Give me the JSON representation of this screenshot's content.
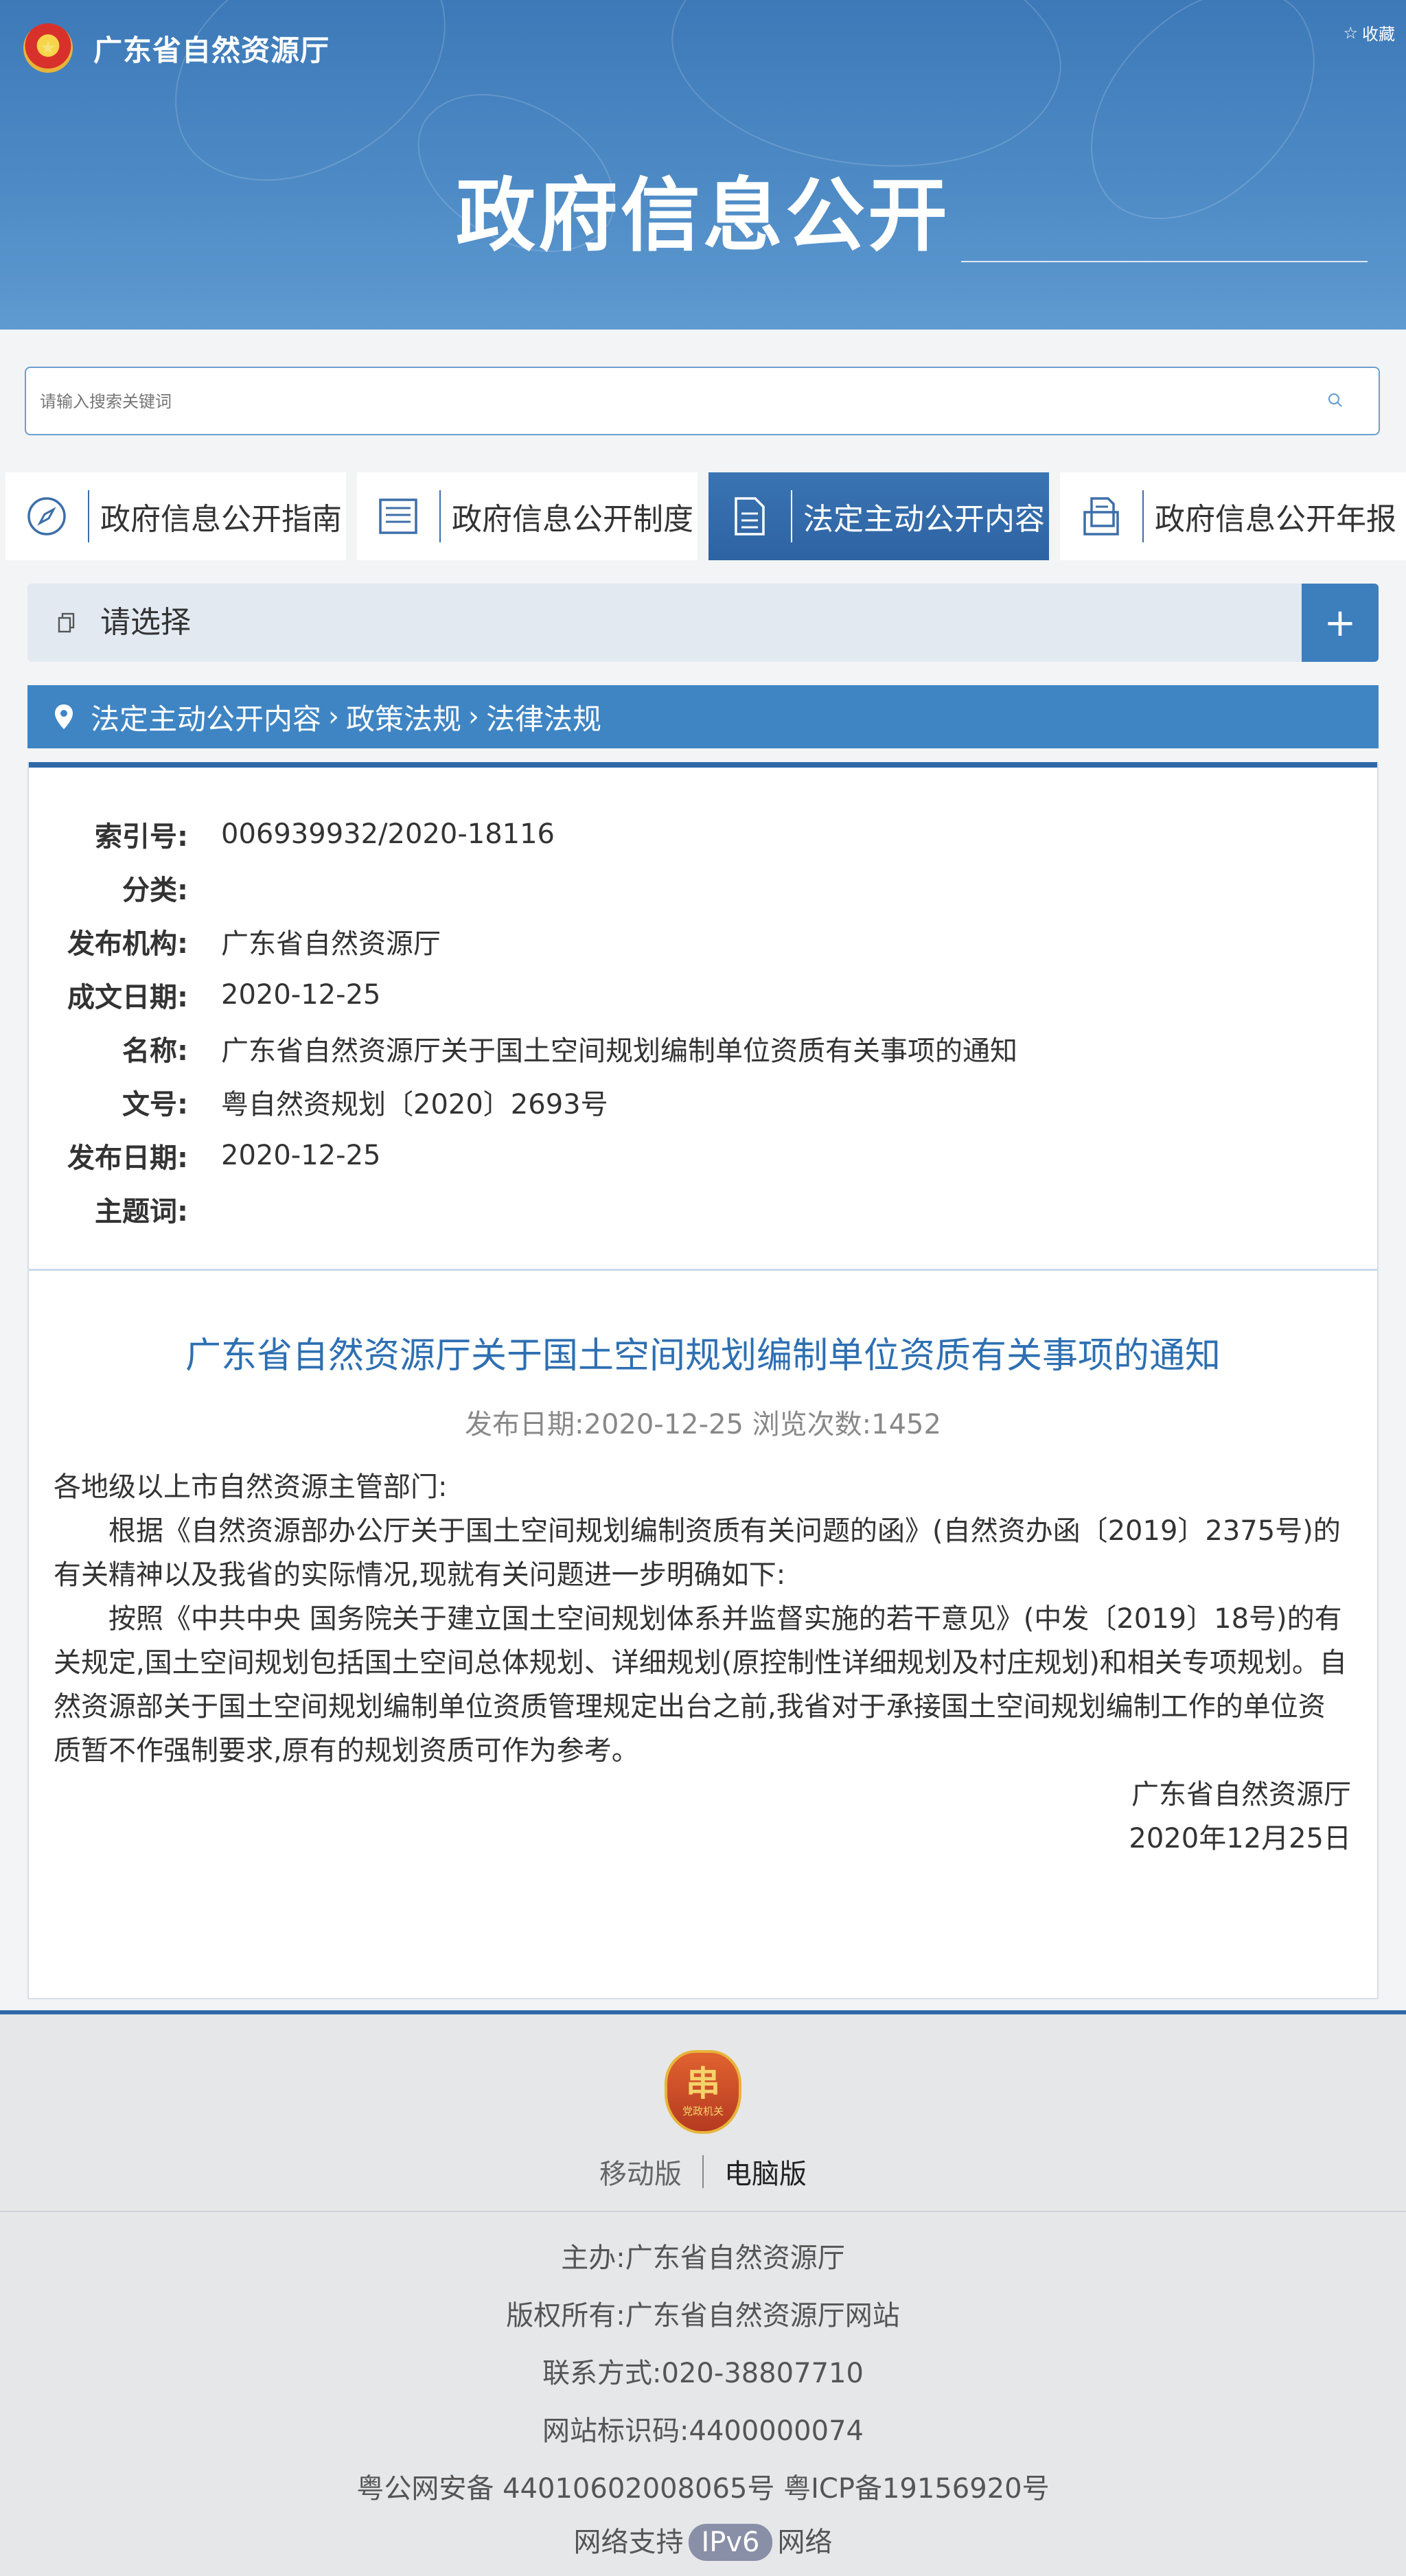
{
  "header": {
    "site_name": "广东省自然资源厅",
    "favorite_label": "收藏",
    "banner_title": "政府信息公开"
  },
  "search": {
    "placeholder": "请输入搜索关键词"
  },
  "tabs": [
    {
      "label": "政府信息公开指南",
      "icon": "compass-icon",
      "active": false
    },
    {
      "label": "政府信息公开制度",
      "icon": "list-icon",
      "active": false
    },
    {
      "label": "法定主动公开内容",
      "icon": "document-icon",
      "active": true
    },
    {
      "label": "政府信息公开年报",
      "icon": "report-icon",
      "active": false
    }
  ],
  "selector": {
    "label": "请选择",
    "expand_symbol": "+"
  },
  "breadcrumb": {
    "items": [
      "法定主动公开内容",
      "政策法规",
      "法律法规"
    ]
  },
  "meta": [
    {
      "key": "索引号:",
      "value": "006939932/2020-18116"
    },
    {
      "key": "分类:",
      "value": ""
    },
    {
      "key": "发布机构:",
      "value": "广东省自然资源厅"
    },
    {
      "key": "成文日期:",
      "value": "2020-12-25"
    },
    {
      "key": "名称:",
      "value": "广东省自然资源厅关于国土空间规划编制单位资质有关事项的通知"
    },
    {
      "key": "文号:",
      "value": "粤自然资规划〔2020〕2693号"
    },
    {
      "key": "发布日期:",
      "value": "2020-12-25"
    },
    {
      "key": "主题词:",
      "value": ""
    }
  ],
  "article": {
    "title": "广东省自然资源厅关于国土空间规划编制单位资质有关事项的通知",
    "info": "发布日期:2020-12-25  浏览次数:1452",
    "greeting": "各地级以上市自然资源主管部门:",
    "para1": "根据《自然资源部办公厅关于国土空间规划编制资质有关问题的函》(自然资办函〔2019〕2375号)的有关精神以及我省的实际情况,现就有关问题进一步明确如下:",
    "para2": "按照《中共中央 国务院关于建立国土空间规划体系并监督实施的若干意见》(中发〔2019〕18号)的有关规定,国土空间规划包括国土空间总体规划、详细规划(原控制性详细规划及村庄规划)和相关专项规划。自然资源部关于国土空间规划编制单位资质管理规定出台之前,我省对于承接国土空间规划编制工作的单位资质暂不作强制要求,原有的规划资质可作为参考。",
    "signature": "广东省自然资源厅",
    "date": "2020年12月25日"
  },
  "footer": {
    "badge_char": "串",
    "badge_text": "党政机关",
    "mobile": "移动版",
    "desktop": "电脑版",
    "sponsor": "主办:广东省自然资源厅",
    "copyright": "版权所有:广东省自然资源厅网站",
    "contact": "联系方式:020-38807710",
    "site_code": "网站标识码:4400000074",
    "records": "粤公网安备 44010602008065号 粤ICP备19156920号",
    "network_pre": "网络支持",
    "network_badge": "IPv6",
    "network_post": "网络"
  }
}
